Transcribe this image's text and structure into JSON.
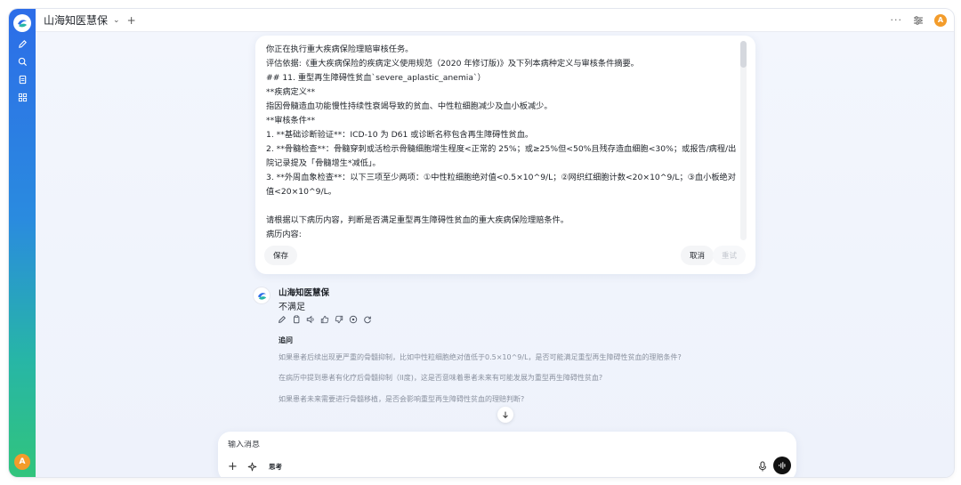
{
  "app": {
    "title": "山海知医慧保",
    "user_initial": "A"
  },
  "colors": {
    "accent": "#2d6de8",
    "avatar": "#f39c2b"
  },
  "sidebar": {
    "icons": [
      "edit-icon",
      "search-icon",
      "document-icon",
      "apps-icon"
    ]
  },
  "topbar": {
    "more": "···"
  },
  "edit_card": {
    "lines": [
      "你正在执行重大疾病保险理赔审核任务。",
      "评估依据:《重大疾病保险的疾病定义使用规范（2020 年修订版)》及下列本病种定义与审核条件摘要。",
      "## 11. 重型再生障碍性贫血`severe_aplastic_anemia`）",
      "**疾病定义**",
      "指因骨髓造血功能慢性持续性衰竭导致的贫血、中性粒细胞减少及血小板减少。",
      "**审核条件**",
      "1. **基础诊断验证**：ICD-10 为 D61 或诊断名称包含再生障碍性贫血。",
      "2. **骨髓检查**：骨髓穿刺或活检示骨髓细胞增生程度<正常的 25%；或≥25%但<50%且残存造血细胞<30%；或报告/病程/出院记录提及「骨髓增生*减低」。",
      "3. **外周血象检查**：以下三项至少两项：①中性粒细胞绝对值<0.5×10^9/L；②网织红细胞计数<20×10^9/L；③血小板绝对值<20×10^9/L。",
      "",
      "请根据以下病历内容，判断是否满足重型再生障碍性贫血的重大疾病保险理赔条件。",
      "病历内容:"
    ],
    "save_label": "保存",
    "cancel_label": "取消",
    "send_label": "重试"
  },
  "message": {
    "sender": "山海知医慧保",
    "answer": "不满足",
    "actions": [
      "edit-icon",
      "copy-icon",
      "speaker-icon",
      "thumbs-up-icon",
      "thumbs-down-icon",
      "share-icon",
      "regenerate-icon"
    ]
  },
  "followups": {
    "title": "追问",
    "items": [
      "如果患者后续出现更严重的骨髓抑制，比如中性粒细胞绝对值低于0.5×10^9/L，是否可能满足重型再生障碍性贫血的理赔条件?",
      "在病历中提到患者有化疗后骨髓抑制（II度)，这是否意味着患者未来有可能发展为重型再生障碍性贫血?",
      "如果患者未来需要进行骨髓移植，是否会影响重型再生障碍性贫血的理赔判断?"
    ]
  },
  "composer": {
    "placeholder": "输入消息",
    "think_label": "思考"
  }
}
